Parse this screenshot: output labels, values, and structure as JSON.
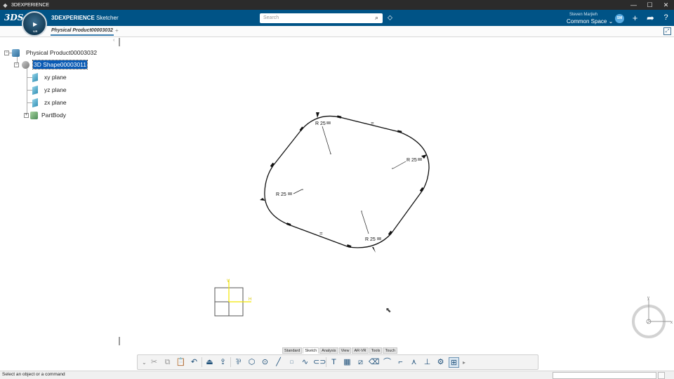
{
  "window": {
    "title": "3DEXPERIENCE",
    "controls": [
      "—",
      "☐",
      "✕"
    ]
  },
  "header": {
    "app_brand": "3DEXPERIENCE",
    "app_sub": "Sketcher",
    "search_placeholder": "Search",
    "user_name": "Steven Marjieh",
    "space_name": "Common Space",
    "avatar_initials": "SM",
    "compass_version": "V.R"
  },
  "tabs": {
    "active": "Physical Product00003032",
    "add": "+"
  },
  "tree": {
    "root": "Physical Product00003032",
    "shape": "3D Shape00003011",
    "xy": "xy plane",
    "yz": "yz plane",
    "zx": "zx plane",
    "body": "PartBody"
  },
  "sketch": {
    "radius_labels": [
      "R 25",
      "R 25",
      "R 25",
      "R 25"
    ],
    "equal_marks": [
      "=",
      "="
    ],
    "axis_h": "H",
    "axis_v": "V"
  },
  "view_compass": {
    "axis_y": "y",
    "axis_x": "x",
    "center": "z"
  },
  "toolbar": {
    "sections": [
      "Standard",
      "Sketch",
      "Analysis",
      "View",
      "AR-VR",
      "Tools",
      "Touch"
    ],
    "active_section": "Sketch"
  },
  "status": {
    "text": "Select an object or a command"
  },
  "colors": {
    "header_bg": "#005386",
    "selection": "#0a5bb5",
    "titlebar": "#2b2b2b"
  }
}
